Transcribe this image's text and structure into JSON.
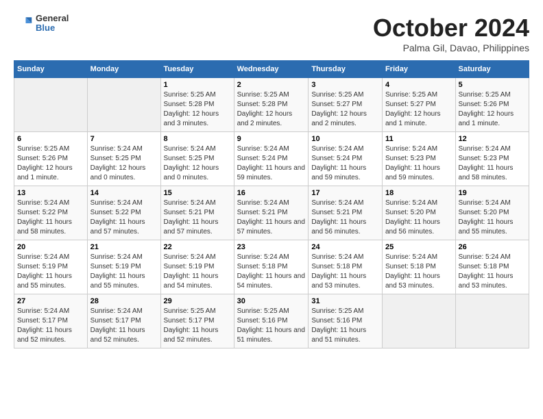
{
  "header": {
    "logo_line1": "General",
    "logo_line2": "Blue",
    "month": "October 2024",
    "location": "Palma Gil, Davao, Philippines"
  },
  "weekdays": [
    "Sunday",
    "Monday",
    "Tuesday",
    "Wednesday",
    "Thursday",
    "Friday",
    "Saturday"
  ],
  "weeks": [
    [
      {
        "day": "",
        "info": ""
      },
      {
        "day": "",
        "info": ""
      },
      {
        "day": "1",
        "info": "Sunrise: 5:25 AM\nSunset: 5:28 PM\nDaylight: 12 hours and 3 minutes."
      },
      {
        "day": "2",
        "info": "Sunrise: 5:25 AM\nSunset: 5:28 PM\nDaylight: 12 hours and 2 minutes."
      },
      {
        "day": "3",
        "info": "Sunrise: 5:25 AM\nSunset: 5:27 PM\nDaylight: 12 hours and 2 minutes."
      },
      {
        "day": "4",
        "info": "Sunrise: 5:25 AM\nSunset: 5:27 PM\nDaylight: 12 hours and 1 minute."
      },
      {
        "day": "5",
        "info": "Sunrise: 5:25 AM\nSunset: 5:26 PM\nDaylight: 12 hours and 1 minute."
      }
    ],
    [
      {
        "day": "6",
        "info": "Sunrise: 5:25 AM\nSunset: 5:26 PM\nDaylight: 12 hours and 1 minute."
      },
      {
        "day": "7",
        "info": "Sunrise: 5:24 AM\nSunset: 5:25 PM\nDaylight: 12 hours and 0 minutes."
      },
      {
        "day": "8",
        "info": "Sunrise: 5:24 AM\nSunset: 5:25 PM\nDaylight: 12 hours and 0 minutes."
      },
      {
        "day": "9",
        "info": "Sunrise: 5:24 AM\nSunset: 5:24 PM\nDaylight: 11 hours and 59 minutes."
      },
      {
        "day": "10",
        "info": "Sunrise: 5:24 AM\nSunset: 5:24 PM\nDaylight: 11 hours and 59 minutes."
      },
      {
        "day": "11",
        "info": "Sunrise: 5:24 AM\nSunset: 5:23 PM\nDaylight: 11 hours and 59 minutes."
      },
      {
        "day": "12",
        "info": "Sunrise: 5:24 AM\nSunset: 5:23 PM\nDaylight: 11 hours and 58 minutes."
      }
    ],
    [
      {
        "day": "13",
        "info": "Sunrise: 5:24 AM\nSunset: 5:22 PM\nDaylight: 11 hours and 58 minutes."
      },
      {
        "day": "14",
        "info": "Sunrise: 5:24 AM\nSunset: 5:22 PM\nDaylight: 11 hours and 57 minutes."
      },
      {
        "day": "15",
        "info": "Sunrise: 5:24 AM\nSunset: 5:21 PM\nDaylight: 11 hours and 57 minutes."
      },
      {
        "day": "16",
        "info": "Sunrise: 5:24 AM\nSunset: 5:21 PM\nDaylight: 11 hours and 57 minutes."
      },
      {
        "day": "17",
        "info": "Sunrise: 5:24 AM\nSunset: 5:21 PM\nDaylight: 11 hours and 56 minutes."
      },
      {
        "day": "18",
        "info": "Sunrise: 5:24 AM\nSunset: 5:20 PM\nDaylight: 11 hours and 56 minutes."
      },
      {
        "day": "19",
        "info": "Sunrise: 5:24 AM\nSunset: 5:20 PM\nDaylight: 11 hours and 55 minutes."
      }
    ],
    [
      {
        "day": "20",
        "info": "Sunrise: 5:24 AM\nSunset: 5:19 PM\nDaylight: 11 hours and 55 minutes."
      },
      {
        "day": "21",
        "info": "Sunrise: 5:24 AM\nSunset: 5:19 PM\nDaylight: 11 hours and 55 minutes."
      },
      {
        "day": "22",
        "info": "Sunrise: 5:24 AM\nSunset: 5:19 PM\nDaylight: 11 hours and 54 minutes."
      },
      {
        "day": "23",
        "info": "Sunrise: 5:24 AM\nSunset: 5:18 PM\nDaylight: 11 hours and 54 minutes."
      },
      {
        "day": "24",
        "info": "Sunrise: 5:24 AM\nSunset: 5:18 PM\nDaylight: 11 hours and 53 minutes."
      },
      {
        "day": "25",
        "info": "Sunrise: 5:24 AM\nSunset: 5:18 PM\nDaylight: 11 hours and 53 minutes."
      },
      {
        "day": "26",
        "info": "Sunrise: 5:24 AM\nSunset: 5:18 PM\nDaylight: 11 hours and 53 minutes."
      }
    ],
    [
      {
        "day": "27",
        "info": "Sunrise: 5:24 AM\nSunset: 5:17 PM\nDaylight: 11 hours and 52 minutes."
      },
      {
        "day": "28",
        "info": "Sunrise: 5:24 AM\nSunset: 5:17 PM\nDaylight: 11 hours and 52 minutes."
      },
      {
        "day": "29",
        "info": "Sunrise: 5:25 AM\nSunset: 5:17 PM\nDaylight: 11 hours and 52 minutes."
      },
      {
        "day": "30",
        "info": "Sunrise: 5:25 AM\nSunset: 5:16 PM\nDaylight: 11 hours and 51 minutes."
      },
      {
        "day": "31",
        "info": "Sunrise: 5:25 AM\nSunset: 5:16 PM\nDaylight: 11 hours and 51 minutes."
      },
      {
        "day": "",
        "info": ""
      },
      {
        "day": "",
        "info": ""
      }
    ]
  ]
}
